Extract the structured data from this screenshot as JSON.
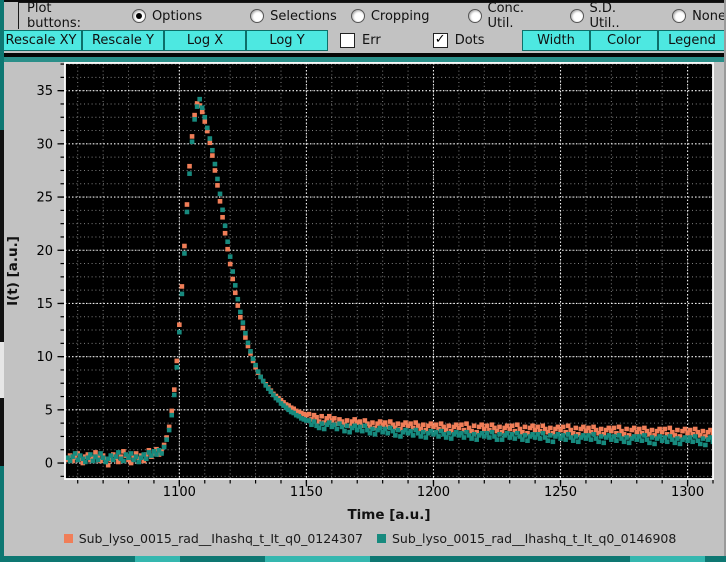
{
  "toolbar": {
    "label": "Plot buttons:",
    "radios": [
      {
        "label": "Options",
        "selected": true
      },
      {
        "label": "Selections",
        "selected": false
      },
      {
        "label": "Cropping",
        "selected": false
      },
      {
        "label": "Conc. Util.",
        "selected": false
      },
      {
        "label": "S.D. Util..",
        "selected": false
      },
      {
        "label": "None",
        "selected": false
      }
    ],
    "buttons_left": [
      "Rescale XY",
      "Rescale Y",
      "Log X",
      "Log Y"
    ],
    "checkboxes": [
      {
        "label": "Err",
        "checked": false
      },
      {
        "label": "Dots",
        "checked": true
      }
    ],
    "buttons_right": [
      "Width",
      "Color",
      "Legend"
    ],
    "button_color": "#4de8e1",
    "check_glyph": "✓"
  },
  "chart_data": {
    "type": "scatter",
    "xlabel": "Time [a.u.]",
    "ylabel": "I(t) [a.u.]",
    "xlim": [
      1055,
      1310
    ],
    "ylim": [
      -1.5,
      37.6
    ],
    "x_major_ticks": [
      1100,
      1150,
      1200,
      1250,
      1300
    ],
    "x_minor_step": 10,
    "y_major_ticks": [
      0,
      5,
      10,
      15,
      20,
      25,
      30,
      35
    ],
    "y_minor_step": 1.25,
    "plot_bg": "#000000",
    "grid_color": "#ffffff",
    "grid_style": "dotted",
    "legend_position": "below-axes",
    "t_start": 1056,
    "t_step": 1,
    "series": [
      {
        "name": "Sub_lyso_0015_rad__Ihashq_t_It_q0_0124307",
        "color": "#f07e58",
        "marker": "square",
        "values": [
          0.3,
          0.7,
          0.2,
          0.5,
          0.9,
          0.4,
          0.0,
          0.6,
          0.8,
          0.3,
          0.5,
          1.0,
          0.6,
          0.2,
          0.7,
          0.4,
          -0.2,
          0.3,
          0.8,
          0.5,
          0.1,
          0.6,
          1.1,
          0.7,
          0.3,
          0.0,
          0.5,
          0.9,
          0.4,
          0.7,
          0.2,
          0.8,
          1.2,
          0.6,
          0.9,
          1.3,
          0.8,
          1.1,
          1.7,
          2.4,
          3.4,
          4.9,
          6.9,
          9.6,
          13.0,
          16.6,
          20.4,
          24.3,
          27.9,
          30.7,
          32.7,
          33.8,
          33.6,
          33.0,
          32.1,
          31.2,
          30.1,
          28.9,
          27.5,
          26.1,
          24.6,
          23.1,
          21.6,
          20.1,
          18.7,
          17.3,
          16.0,
          14.8,
          13.7,
          12.7,
          11.8,
          11.0,
          10.3,
          9.6,
          9.0,
          8.5,
          8.1,
          7.7,
          7.4,
          7.1,
          6.8,
          6.5,
          6.3,
          6.1,
          5.9,
          5.7,
          5.5,
          5.4,
          5.2,
          5.1,
          4.9,
          4.8,
          4.7,
          4.6,
          4.5,
          4.6,
          4.1,
          4.5,
          4.3,
          3.9,
          4.4,
          3.8,
          4.2,
          4.4,
          4.0,
          4.2,
          3.7,
          4.1,
          3.9,
          3.6,
          4.0,
          3.5,
          3.9,
          4.1,
          3.8,
          3.9,
          3.5,
          4.0,
          3.7,
          3.4,
          3.8,
          3.3,
          3.7,
          3.9,
          3.6,
          3.8,
          3.4,
          3.9,
          3.6,
          3.3,
          3.7,
          3.2,
          3.6,
          3.8,
          3.5,
          3.7,
          3.3,
          3.8,
          3.5,
          3.2,
          3.6,
          3.1,
          3.5,
          3.7,
          3.4,
          3.6,
          3.2,
          3.7,
          3.4,
          3.1,
          3.5,
          3.0,
          3.4,
          3.6,
          3.3,
          3.6,
          3.1,
          3.7,
          3.3,
          3.0,
          3.5,
          2.9,
          3.4,
          3.6,
          3.2,
          3.5,
          3.1,
          3.6,
          3.3,
          3.0,
          3.4,
          2.9,
          3.3,
          3.5,
          3.2,
          3.5,
          3.0,
          3.6,
          3.2,
          2.9,
          3.4,
          2.8,
          3.3,
          3.5,
          3.1,
          3.4,
          3.0,
          3.5,
          3.2,
          2.9,
          3.3,
          2.8,
          3.2,
          3.4,
          3.1,
          3.4,
          2.9,
          3.5,
          3.1,
          2.8,
          3.3,
          2.7,
          3.2,
          3.4,
          3.0,
          3.3,
          2.9,
          3.4,
          3.1,
          2.8,
          3.2,
          2.7,
          3.1,
          3.3,
          3.0,
          3.3,
          2.8,
          3.4,
          3.0,
          2.7,
          3.2,
          2.6,
          3.1,
          3.3,
          2.9,
          3.2,
          2.8,
          3.3,
          3.0,
          2.7,
          3.1,
          2.6,
          3.0,
          3.2,
          2.9,
          3.2,
          2.7,
          3.3,
          2.9,
          2.6,
          3.1,
          2.5,
          3.0,
          3.2,
          2.8,
          3.1,
          2.7,
          3.2,
          2.9,
          2.6,
          3.0,
          2.5,
          2.9,
          3.1,
          2.8
        ]
      },
      {
        "name": "Sub_lyso_0015_rad__Ihashq_t_It_q0_0146908",
        "color": "#178a7e",
        "marker": "square",
        "values": [
          0.5,
          0.2,
          0.6,
          0.9,
          0.3,
          0.7,
          0.4,
          0.1,
          0.5,
          0.8,
          0.2,
          0.6,
          0.3,
          0.9,
          0.5,
          0.1,
          0.4,
          0.7,
          0.3,
          0.6,
          1.0,
          0.4,
          0.2,
          0.8,
          0.5,
          0.9,
          0.3,
          0.6,
          0.1,
          0.5,
          0.8,
          0.4,
          1.0,
          0.7,
          1.1,
          0.8,
          1.2,
          0.9,
          1.5,
          2.2,
          3.1,
          4.5,
          6.4,
          9.0,
          12.3,
          15.9,
          19.7,
          23.6,
          27.2,
          30.2,
          32.3,
          33.5,
          34.2,
          33.4,
          32.5,
          31.5,
          30.5,
          29.4,
          28.1,
          26.7,
          25.3,
          23.8,
          22.3,
          20.8,
          19.4,
          18.0,
          16.7,
          15.4,
          14.2,
          13.2,
          12.2,
          11.3,
          10.5,
          9.8,
          9.2,
          8.6,
          8.1,
          7.7,
          7.3,
          7.0,
          6.7,
          6.4,
          6.1,
          5.9,
          5.6,
          5.4,
          5.2,
          5.0,
          4.8,
          4.7,
          4.5,
          4.4,
          4.2,
          4.1,
          4.0,
          4.0,
          3.6,
          3.9,
          3.5,
          3.3,
          3.7,
          3.2,
          3.6,
          3.8,
          3.4,
          3.6,
          3.2,
          3.7,
          3.4,
          3.0,
          3.5,
          2.9,
          3.3,
          3.5,
          3.1,
          3.4,
          3.0,
          3.5,
          3.1,
          2.8,
          3.2,
          2.7,
          3.1,
          3.3,
          2.9,
          3.2,
          2.8,
          3.3,
          3.0,
          2.6,
          3.1,
          2.5,
          2.9,
          3.1,
          2.8,
          3.0,
          2.6,
          3.1,
          2.8,
          2.5,
          2.9,
          2.4,
          2.8,
          3.0,
          2.7,
          2.9,
          2.5,
          3.0,
          2.7,
          2.4,
          2.8,
          2.3,
          2.7,
          2.9,
          2.6,
          2.8,
          2.4,
          2.9,
          2.6,
          2.3,
          2.7,
          2.2,
          2.6,
          2.8,
          2.5,
          2.8,
          2.4,
          2.9,
          2.5,
          2.2,
          2.7,
          2.2,
          2.6,
          2.8,
          2.4,
          2.7,
          2.3,
          2.8,
          2.5,
          2.2,
          2.6,
          2.1,
          2.5,
          2.7,
          2.4,
          2.7,
          2.3,
          2.8,
          2.4,
          2.1,
          2.6,
          2.0,
          2.5,
          2.7,
          2.3,
          2.6,
          2.2,
          2.7,
          2.4,
          2.1,
          2.5,
          2.0,
          2.4,
          2.6,
          2.3,
          2.6,
          2.2,
          2.7,
          2.3,
          2.0,
          2.5,
          1.9,
          2.4,
          2.6,
          2.2,
          2.5,
          2.1,
          2.6,
          2.3,
          2.0,
          2.4,
          1.9,
          2.3,
          2.5,
          2.2,
          2.5,
          2.1,
          2.6,
          2.2,
          1.9,
          2.4,
          1.8,
          2.3,
          2.5,
          2.1,
          2.4,
          2.0,
          2.5,
          2.2,
          1.9,
          2.3,
          1.8,
          2.2,
          2.4,
          2.1,
          2.4,
          2.0,
          2.5,
          2.1,
          1.8,
          2.3,
          1.7,
          2.2,
          2.4,
          2.0
        ]
      }
    ]
  }
}
